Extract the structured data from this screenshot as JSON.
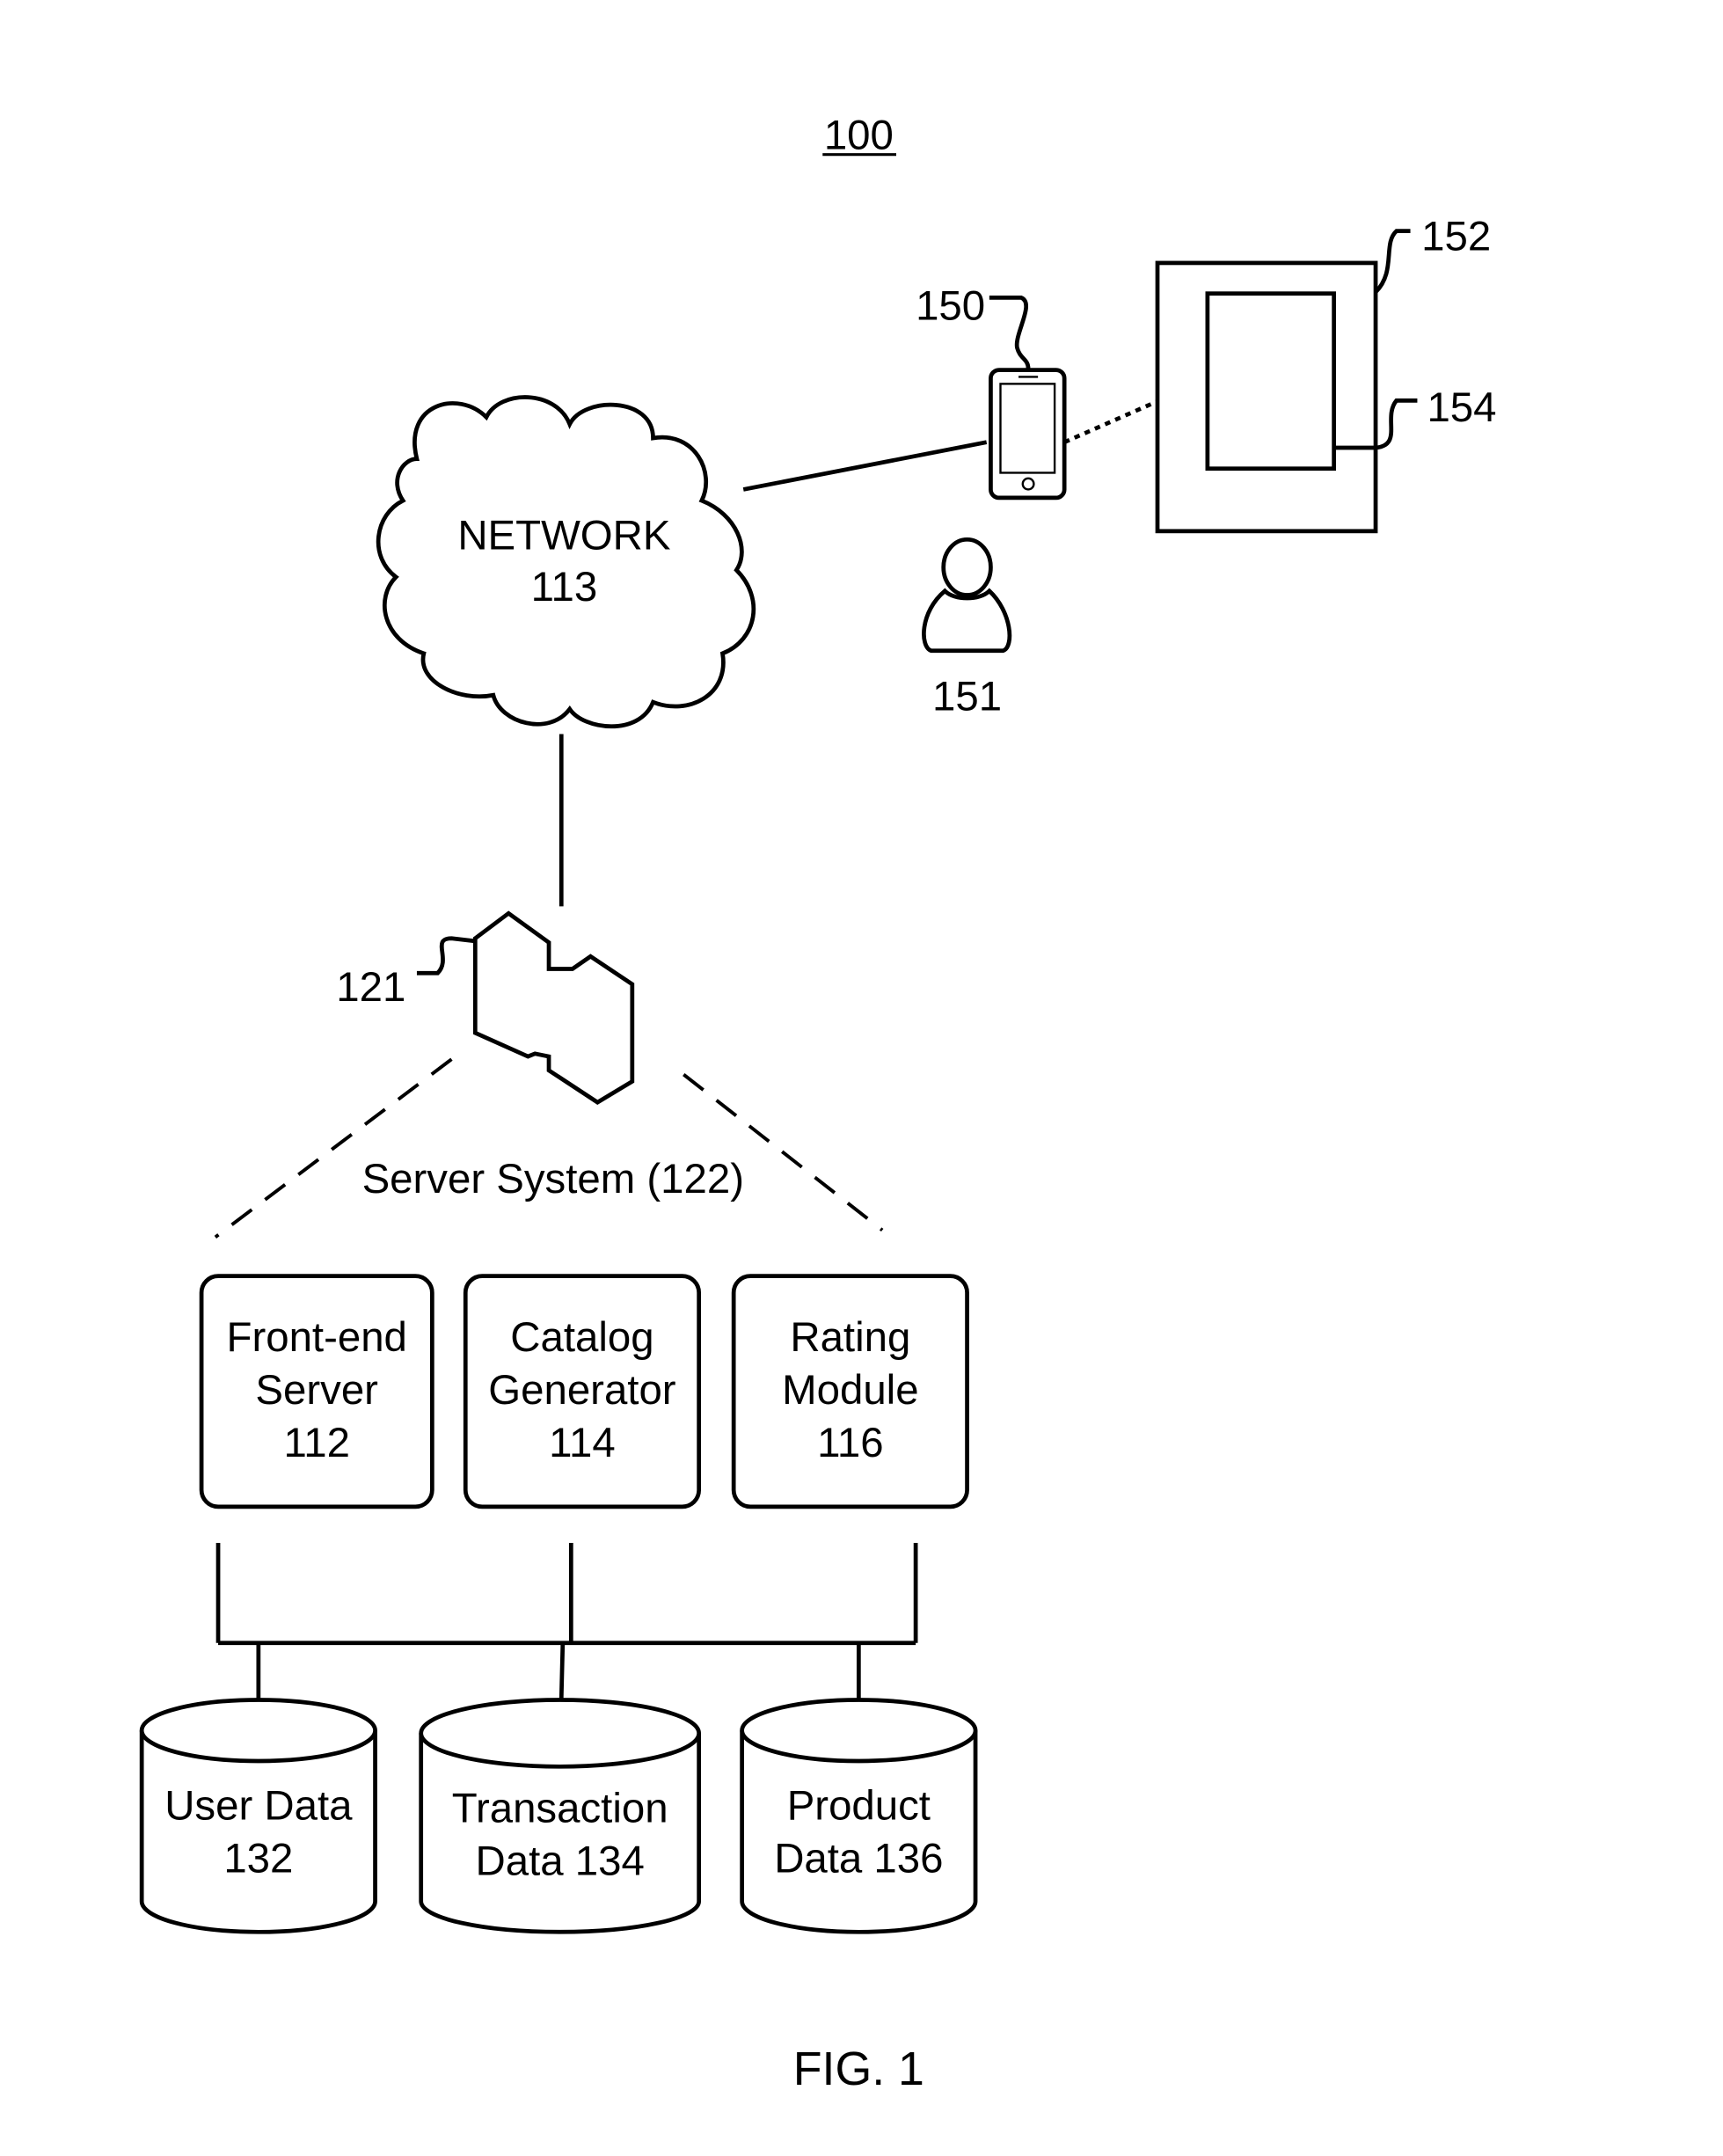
{
  "figure": {
    "number_label": "100",
    "caption": "FIG. 1"
  },
  "network": {
    "name": "NETWORK",
    "ref": "113"
  },
  "mobile_device": {
    "ref": "150",
    "icon": "smartphone-icon"
  },
  "user": {
    "ref": "151",
    "icon": "person-icon"
  },
  "display_device": {
    "ref": "152",
    "screen_ref": "154"
  },
  "server": {
    "ref": "121",
    "label": "Server System (122)",
    "icon": "server-icon"
  },
  "modules": [
    {
      "line1": "Front-end",
      "line2": "Server",
      "ref": "112"
    },
    {
      "line1": "Catalog",
      "line2": "Generator",
      "ref": "114"
    },
    {
      "line1": "Rating",
      "line2": "Module",
      "ref": "116"
    }
  ],
  "databases": [
    {
      "line1": "User Data",
      "line2": "132"
    },
    {
      "line1": "Transaction",
      "line2": "Data 134"
    },
    {
      "line1": "Product",
      "line2": "Data 136"
    }
  ]
}
